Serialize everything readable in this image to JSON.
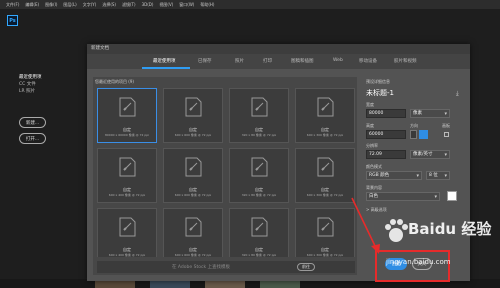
{
  "menubar": {
    "items": [
      "文件(F)",
      "编辑(E)",
      "图像(I)",
      "图层(L)",
      "文字(Y)",
      "选择(S)",
      "滤镜(T)",
      "3D(D)",
      "视图(V)",
      "窗口(W)",
      "帮助(H)"
    ]
  },
  "app_logo": "Ps",
  "start": {
    "items": [
      {
        "label": "最近使用项",
        "active": true
      },
      {
        "label": "CC 文件",
        "active": false
      },
      {
        "label": "LR 照片",
        "active": false
      }
    ],
    "new_button": "新建...",
    "open_button": "打开..."
  },
  "dialog": {
    "title": "新建文档",
    "tabs": [
      "最近使用项",
      "已保存",
      "照片",
      "打印",
      "图稿和插图",
      "Web",
      "移动设备",
      "胶片和视频"
    ],
    "section_header": "您最近使用的项目 (9)",
    "presets": [
      {
        "name": "自定",
        "size": "80000 x 60000 像素 @ 72 ppi",
        "selected": true
      },
      {
        "name": "自定",
        "size": "600 x 600 像素 @ 72 ppi",
        "selected": false
      },
      {
        "name": "自定",
        "size": "320 x 80 像素 @ 72 ppi",
        "selected": false
      },
      {
        "name": "自定",
        "size": "600 x 300 像素 @ 72 ppi",
        "selected": false
      },
      {
        "name": "自定",
        "size": "600 x 400 像素 @ 72 ppi",
        "selected": false
      },
      {
        "name": "自定",
        "size": "600 x 600 像素 @ 72 ppi",
        "selected": false
      },
      {
        "name": "自定",
        "size": "320 x 80 像素 @ 72 ppi",
        "selected": false
      },
      {
        "name": "自定",
        "size": "600 x 300 像素 @ 72 ppi",
        "selected": false
      },
      {
        "name": "自定",
        "size": "600 x 400 像素 @ 72 ppi",
        "selected": false
      },
      {
        "name": "自定",
        "size": "600 x 600 像素 @ 72 ppi",
        "selected": false
      },
      {
        "name": "自定",
        "size": "320 x 80 像素 @ 72 ppi",
        "selected": false
      },
      {
        "name": "自定",
        "size": "600 x 300 像素 @ 72 ppi",
        "selected": false
      }
    ],
    "search_placeholder": "在 Adobe Stock 上查找模板",
    "go_button": "前往",
    "details": {
      "heading": "预设详细信息",
      "doc_name": "未标题-1",
      "width_label": "宽度",
      "width_value": "80000",
      "width_unit": "像素",
      "height_label": "高度",
      "height_value": "60000",
      "orientation_label": "方向",
      "artboard_label": "画板",
      "resolution_label": "分辨率",
      "resolution_value": "72.09",
      "resolution_unit": "像素/英寸",
      "color_mode_label": "颜色模式",
      "color_mode": "RGB 颜色",
      "bit_depth": "8 位",
      "background_label": "背景内容",
      "background": "白色",
      "advanced_label": "> 高级选项"
    },
    "create_button": "创建",
    "close_button": "关闭"
  },
  "watermark": {
    "logo": "Baidu 经验",
    "url": "jingyan.baidu.com"
  },
  "colors": {
    "accent": "#2f8de4",
    "highlight": "#e62b2b",
    "dialog_bg": "#535353"
  }
}
